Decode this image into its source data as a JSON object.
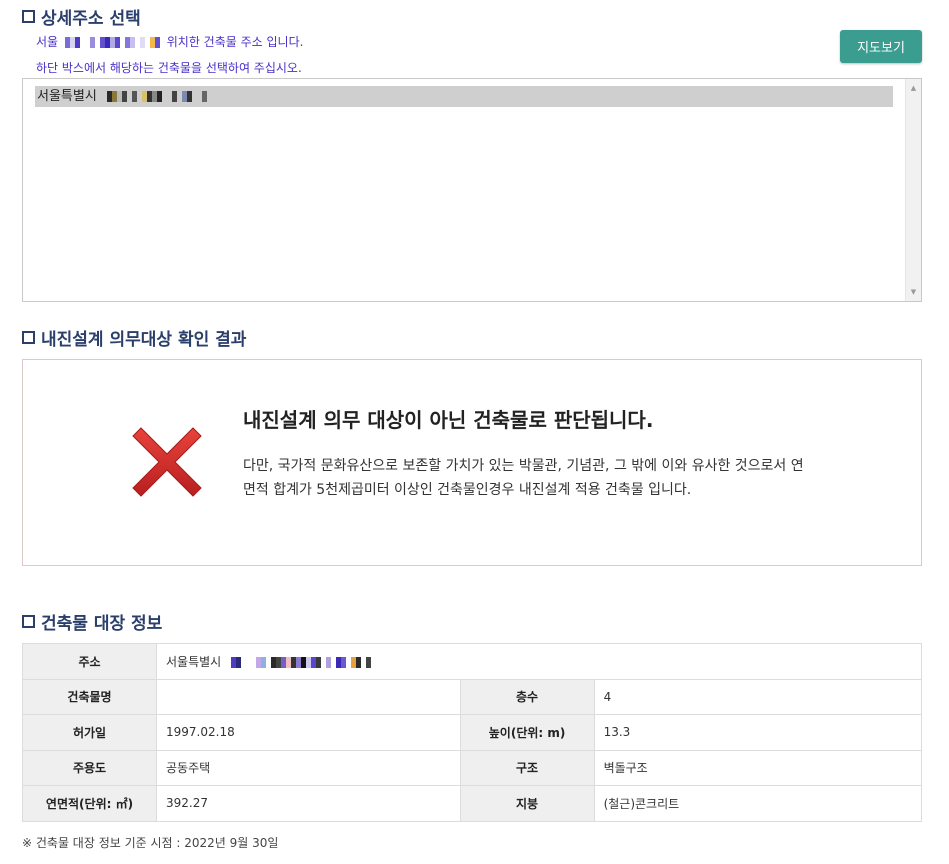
{
  "detail_section": {
    "title": "상세주소 선택",
    "guide_prefix": "서울",
    "guide_suffix": "위치한 건축물 주소 입니다.",
    "guide_line2": "하단 박스에서 해당하는 건축물을 선택하여 주십시오.",
    "map_button": "지도보기",
    "list_item_prefix": "서울특별시"
  },
  "result_section": {
    "title": "내진설계 의무대상 확인 결과",
    "headline": "내진설계 의무 대상이 아닌 건축물로 판단됩니다.",
    "description": "다만, 국가적 문화유산으로 보존할 가치가 있는 박물관, 기념관, 그 밖에 이와 유사한 것으로서 연면적 합계가 5천제곱미터 이상인 건축물인경우 내진설계 적용 건축물 입니다."
  },
  "ledger_section": {
    "title": "건축물 대장 정보",
    "address_label": "주소",
    "address_value_prefix": "서울특별시",
    "rows": [
      {
        "label1": "건축물명",
        "value1": "",
        "label2": "층수",
        "value2": "4"
      },
      {
        "label1": "허가일",
        "value1": "1997.02.18",
        "label2": "높이(단위: m)",
        "value2": "13.3"
      },
      {
        "label1": "주용도",
        "value1": "공동주택",
        "label2": "구조",
        "value2": "벽돌구조"
      },
      {
        "label1": "연면적(단위: ㎡)",
        "value1": "392.27",
        "label2": "지붕",
        "value2": "(철근)콘크리트"
      }
    ],
    "footnote": "※ 건축물 대장 정보 기준 시점 : 2022년 9월 30일"
  },
  "colors": {
    "title_navy": "#2b3f6b",
    "guide_purple": "#4a2fc9",
    "button_teal": "#3a9d8f",
    "x_red": "#d42a2a"
  },
  "icons": {
    "checkbox_square": "section-square-icon",
    "result_mark": "red-x-icon"
  }
}
